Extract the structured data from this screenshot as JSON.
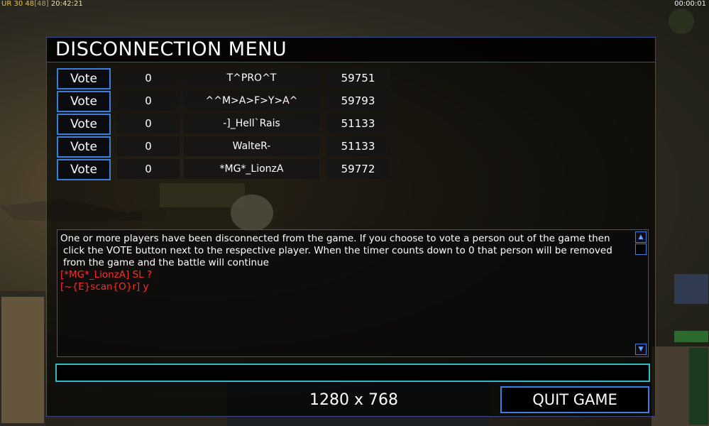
{
  "hud": {
    "ur_label": "UR",
    "stat1": "30",
    "stat2": "48",
    "stat2_bracket": "[48]",
    "clock": "20:42:21",
    "timer": "00:00:01"
  },
  "menu": {
    "title": "DISCONNECTION MENU",
    "vote_label": "Vote",
    "players": [
      {
        "count": "0",
        "name": "T^PRO^T",
        "score": "59751"
      },
      {
        "count": "0",
        "name": "^^M>A>F>Y>A^",
        "score": "59793"
      },
      {
        "count": "0",
        "name": "-]_Hell`Rais",
        "score": "51133"
      },
      {
        "count": "0",
        "name": "WalteR-",
        "score": "51133"
      },
      {
        "count": "0",
        "name": "*MG*_LionzA",
        "score": "59772"
      }
    ],
    "chat": {
      "line1": "One or more players have been disconnected from the game. If you choose to vote a person out of the game then",
      "line2": "click the VOTE button next to the respective player. When the timer counts down to 0 that person will be removed",
      "line3": "from the game and the battle will continue",
      "msg1": "[*MG*_LionzA] SL ?",
      "msg2": "[~{E}scan{O}r] y"
    },
    "quit_label": "QUIT GAME"
  },
  "overlay": {
    "resolution": "1280 x 768"
  },
  "colors": {
    "border_blue": "#3b7ee0",
    "input_cyan": "#2fbac0",
    "chat_red": "#ff2a2a"
  }
}
